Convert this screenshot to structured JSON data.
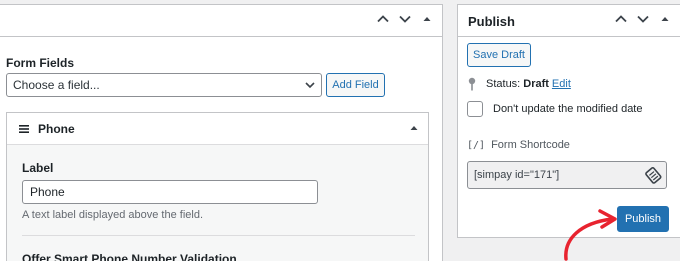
{
  "form_fields": {
    "title": "Form Fields",
    "select_placeholder": "Choose a field...",
    "add_button": "Add Field"
  },
  "field_card": {
    "name": "Phone",
    "label_title": "Label",
    "label_value": "Phone",
    "label_help": "A text label displayed above the field.",
    "next_option_title": "Offer Smart Phone Number Validation"
  },
  "publish_box": {
    "title": "Publish",
    "save_draft": "Save Draft",
    "status_label": "Status:",
    "status_value": "Draft",
    "status_edit": "Edit",
    "modified_checkbox_label": "Don't update the modified date",
    "shortcode_icon": "[/]",
    "shortcode_label": "Form Shortcode",
    "shortcode_value": "[simpay id=\"171\"]",
    "publish_button": "Publish"
  },
  "icons": {
    "up": "chevron-up-icon",
    "down": "chevron-down-icon",
    "toggle": "triangle-up-icon",
    "pin": "pin-icon",
    "copy": "clipboard-icon",
    "drag": "menu-icon"
  },
  "colors": {
    "accent": "#2271b1",
    "annotation_arrow": "#e8232f"
  }
}
